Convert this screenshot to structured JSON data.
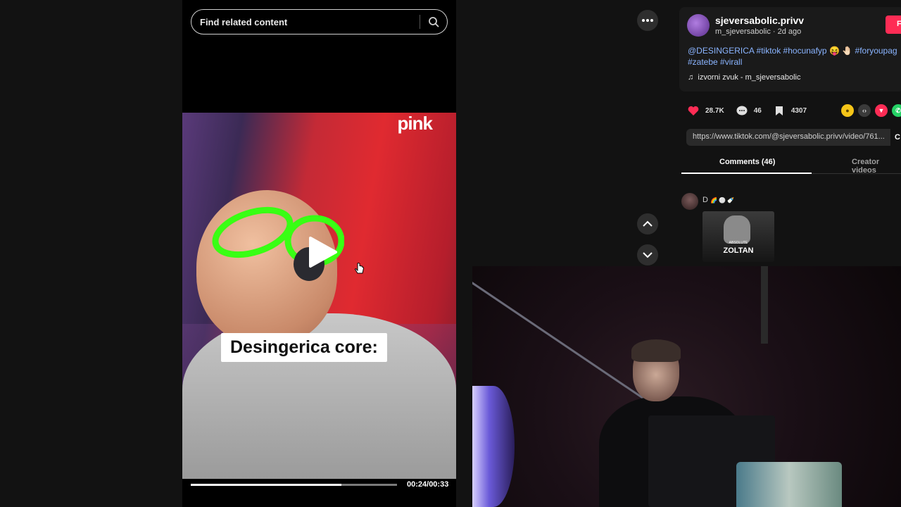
{
  "search": {
    "placeholder": "Find related content"
  },
  "video": {
    "brand_logo": "pink",
    "caption": "Desingerica core:",
    "progress_fraction": 0.73,
    "time": "00:24/00:33"
  },
  "post": {
    "username": "sjeversabolic.privv",
    "handle_date": "m_sjeversabolic · 2d ago",
    "follow_label": "F",
    "description_line1": "@DESINGERICA #tiktok #hocunafyp",
    "description_emoji": "😝 🤚🏻",
    "description_tail": "#foryoupag",
    "description_line2": "#zatebe #virall",
    "music": "izvorni zvuk - m_sjeversabolic"
  },
  "stats": {
    "likes": "28.7K",
    "comments": "46",
    "saves": "4307"
  },
  "share_colors": [
    "#f5c518",
    "#3a3a3a",
    "#fe2c55",
    "#25d366"
  ],
  "link": {
    "url": "https://www.tiktok.com/@sjeversabolic.privv/video/761...",
    "copy_label": "C"
  },
  "tabs": {
    "comments": "Comments (46)",
    "creator_videos": "Creator videos"
  },
  "comment": {
    "author": "D",
    "author_badges": "🌈 ⚪ 🍼",
    "sticker_subtitle": "ABSOLUTE",
    "sticker_text": "ZOLTAN"
  },
  "icons": [
    "search-icon",
    "more-icon",
    "chevron-up-icon",
    "chevron-down-icon",
    "play-icon",
    "music-note-icon",
    "heart-icon",
    "comment-icon",
    "bookmark-icon",
    "coin-icon",
    "embed-icon",
    "tiktok-share-icon",
    "whatsapp-icon",
    "cursor-icon"
  ],
  "colors": {
    "accent": "#fe2c55",
    "link": "#8ab4ff",
    "panel": "#1a1a1a"
  }
}
